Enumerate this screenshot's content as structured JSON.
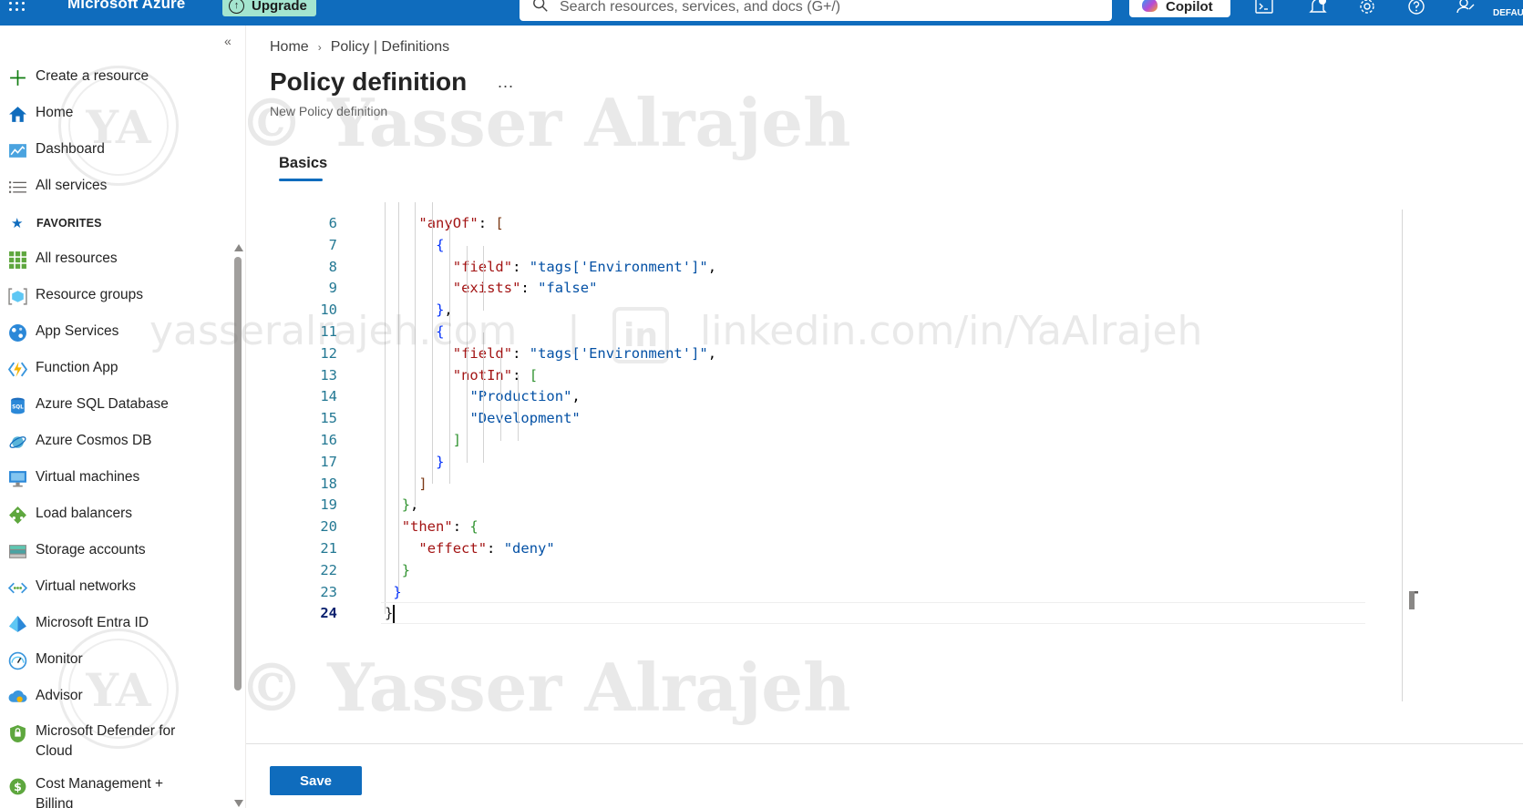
{
  "topbar": {
    "brand": "Microsoft Azure",
    "upgrade_label": "Upgrade",
    "search_placeholder": "Search resources, services, and docs (G+/)",
    "copilot_label": "Copilot",
    "directory_label": "DEFAU",
    "icons": [
      "cloud-shell-icon",
      "notifications-icon",
      "settings-icon",
      "help-icon",
      "feedback-icon"
    ],
    "accent_color": "#0f6cbd"
  },
  "sidebar": {
    "top_items": [
      {
        "label": "Create a resource",
        "icon": "plus-icon"
      },
      {
        "label": "Home",
        "icon": "home-icon"
      },
      {
        "label": "Dashboard",
        "icon": "dashboard-icon"
      },
      {
        "label": "All services",
        "icon": "list-icon"
      }
    ],
    "favorites_label": "FAVORITES",
    "favorites": [
      {
        "label": "All resources",
        "icon": "grid-icon"
      },
      {
        "label": "Resource groups",
        "icon": "resource-group-icon"
      },
      {
        "label": "App Services",
        "icon": "app-services-icon"
      },
      {
        "label": "Function App",
        "icon": "function-app-icon"
      },
      {
        "label": "Azure SQL Database",
        "icon": "sql-database-icon"
      },
      {
        "label": "Azure Cosmos DB",
        "icon": "cosmos-db-icon"
      },
      {
        "label": "Virtual machines",
        "icon": "virtual-machine-icon"
      },
      {
        "label": "Load balancers",
        "icon": "load-balancer-icon"
      },
      {
        "label": "Storage accounts",
        "icon": "storage-icon"
      },
      {
        "label": "Virtual networks",
        "icon": "virtual-network-icon"
      },
      {
        "label": "Microsoft Entra ID",
        "icon": "entra-id-icon"
      },
      {
        "label": "Monitor",
        "icon": "monitor-icon"
      },
      {
        "label": "Advisor",
        "icon": "advisor-icon"
      },
      {
        "label": "Microsoft Defender for Cloud",
        "icon": "defender-icon"
      },
      {
        "label": "Cost Management + Billing",
        "icon": "cost-management-icon"
      }
    ]
  },
  "breadcrumb": [
    "Home",
    "Policy | Definitions"
  ],
  "page": {
    "title": "Policy definition",
    "more_label": "...",
    "subtitle": "New Policy definition",
    "tab_label": "Basics"
  },
  "editor": {
    "current_line": 24,
    "lines": [
      {
        "n": "6",
        "text": "    \"anyOf\": ["
      },
      {
        "n": "7",
        "text": "      {"
      },
      {
        "n": "8",
        "text": "        \"field\": \"tags['Environment']\","
      },
      {
        "n": "9",
        "text": "        \"exists\": \"false\""
      },
      {
        "n": "10",
        "text": "      },"
      },
      {
        "n": "11",
        "text": "      {"
      },
      {
        "n": "12",
        "text": "        \"field\": \"tags['Environment']\","
      },
      {
        "n": "13",
        "text": "        \"notIn\": ["
      },
      {
        "n": "14",
        "text": "          \"Production\","
      },
      {
        "n": "15",
        "text": "          \"Development\""
      },
      {
        "n": "16",
        "text": "        ]"
      },
      {
        "n": "17",
        "text": "      }"
      },
      {
        "n": "18",
        "text": "    ]"
      },
      {
        "n": "19",
        "text": "  },"
      },
      {
        "n": "20",
        "text": "  \"then\": {"
      },
      {
        "n": "21",
        "text": "    \"effect\": \"deny\""
      },
      {
        "n": "22",
        "text": "  }"
      },
      {
        "n": "23",
        "text": " }"
      },
      {
        "n": "24",
        "text": "}"
      }
    ]
  },
  "footer": {
    "save_label": "Save"
  },
  "watermark": {
    "name": "© Yasser Alrajeh",
    "name_lower": "© Yasser Alrajeh",
    "site": "yasseralrajeh.com",
    "divider": "|",
    "linkedin_text": "in",
    "linkedin": "linkedin.com/in/YaAlrajeh",
    "monogram": "YA"
  }
}
